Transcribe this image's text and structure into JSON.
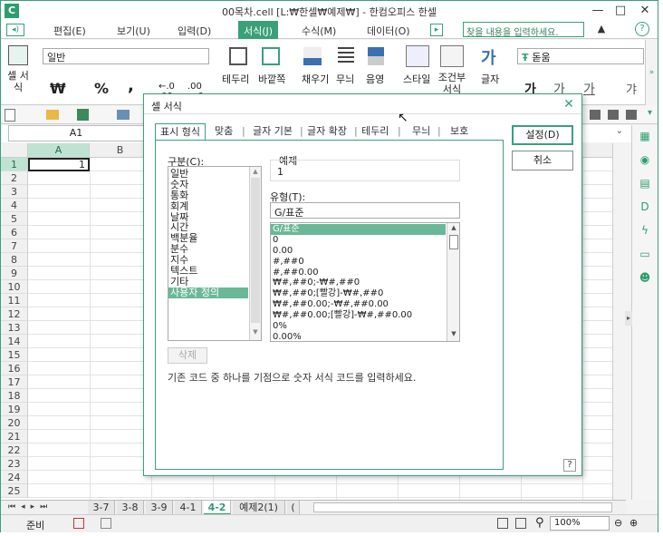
{
  "window": {
    "title": "00목차.cell [L:₩한셀₩예제₩] - 한컴오피스 한셀",
    "logo": "C",
    "min": "—",
    "max": "□",
    "close": "✕"
  },
  "menu": {
    "items": [
      "편집(E)",
      "보기(U)",
      "입력(D)",
      "서식(J)",
      "수식(M)",
      "데이터(O)"
    ],
    "search_placeholder": "찾을 내용을 입력하세요.",
    "help": "?"
  },
  "ribbon": {
    "cell_label": "셀 서식",
    "font_name": "일반",
    "font_face": "돋움",
    "group_labels": [
      "테두리",
      "바깥쪽",
      "채우기",
      "무늬",
      "음영",
      "스타일",
      "조건부 서식",
      "글자"
    ],
    "number_symbols": [
      "₩",
      "%",
      ","
    ],
    "glyphs": [
      "가",
      "가",
      "가",
      "가"
    ]
  },
  "formula": {
    "name_box": "A1"
  },
  "sheet": {
    "columns": [
      "A",
      "B"
    ],
    "rows": [
      "1",
      "2",
      "3",
      "4",
      "5",
      "6",
      "7",
      "8",
      "9",
      "10",
      "11",
      "12",
      "13",
      "14",
      "15",
      "16",
      "17",
      "18",
      "19",
      "20",
      "21",
      "22",
      "23",
      "24",
      "25"
    ],
    "a1_value": "1"
  },
  "tabs": {
    "items": [
      "3-7",
      "3-8",
      "3-9",
      "4-1",
      "4-2",
      "예제2(1)",
      "("
    ],
    "active": "4-2"
  },
  "status": {
    "ready": "준비",
    "zoom": "100%"
  },
  "dialog": {
    "title": "셀 서식",
    "tabs": [
      "표시 형식",
      "맞춤",
      "글자 기본",
      "글자 확장",
      "테두리",
      "무늬",
      "보호"
    ],
    "category_label": "구분(C):",
    "categories": [
      "일반",
      "숫자",
      "통화",
      "회계",
      "날짜",
      "시간",
      "백분율",
      "분수",
      "지수",
      "텍스트",
      "기타",
      "사용자 정의"
    ],
    "selected_category": "사용자 정의",
    "example_label": "예제",
    "example_value": "1",
    "type_label": "유형(T):",
    "type_value": "G/표준",
    "types": [
      "G/표준",
      "0",
      "0.00",
      "#,##0",
      "#,##0.00",
      "₩#,##0;-₩#,##0",
      "₩#,##0;[빨강]-₩#,##0",
      "₩#,##0.00;-₩#,##0.00",
      "₩#,##0.00;[빨강]-₩#,##0.00",
      "0%",
      "0.00%"
    ],
    "delete_label": "삭제",
    "hint": "기존 코드 중 하나를 기점으로 숫자 서식 코드를 입력하세요.",
    "ok_label": "설정(D)",
    "cancel_label": "취소",
    "help": "?"
  }
}
